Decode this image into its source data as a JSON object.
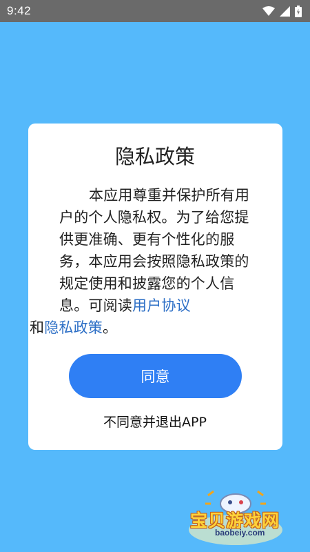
{
  "status_bar": {
    "time": "9:42",
    "icons": [
      "wifi-icon",
      "cellular-signal-icon",
      "battery-icon"
    ]
  },
  "dialog": {
    "title": "隐私政策",
    "body_text": "本应用尊重并保护所有用户的个人隐私权。为了给您提供更准确、更有个性化的服务，本应用会按照隐私政策的规定使用和披露您的个人信息。可阅读",
    "user_agreement_link": "用户协议",
    "conjunction": "和",
    "privacy_policy_link": "隐私政策",
    "end_punct": "。",
    "agree_button": "同意",
    "decline_link": "不同意并退出APP"
  },
  "watermark": {
    "brand": "宝贝游戏网",
    "url": "baobeiy.com"
  },
  "colors": {
    "background": "#55b9fb",
    "status_bar": "#6a6a6a",
    "accent_button": "#2f7ff4",
    "link": "#2d6fc6"
  }
}
